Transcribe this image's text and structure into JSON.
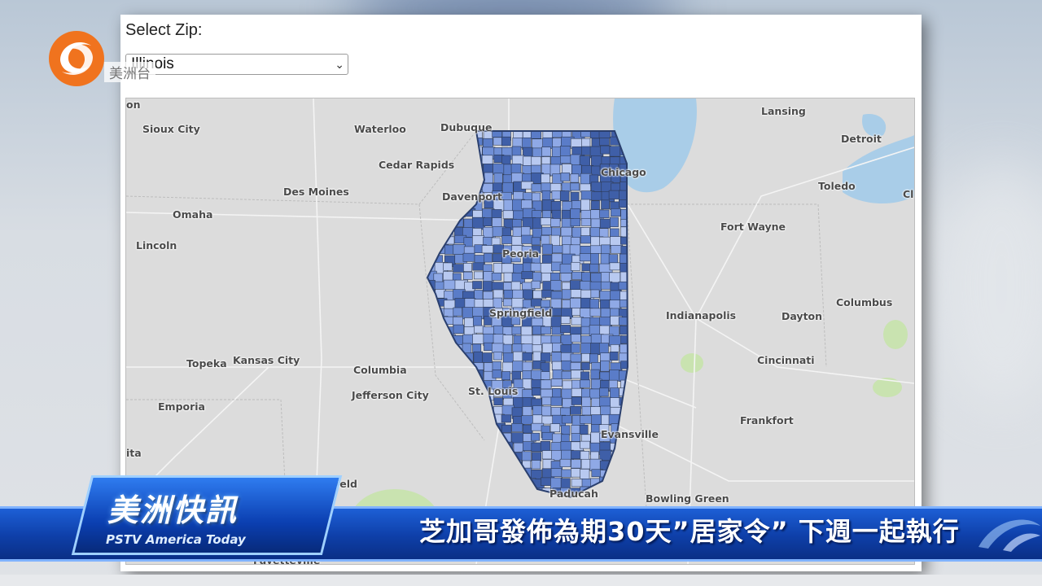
{
  "page": {
    "select_label": "Select Zip:",
    "select_value": "Illinois"
  },
  "map": {
    "cities": [
      {
        "name": "Sioux City"
      },
      {
        "name": "Waterloo"
      },
      {
        "name": "Dubuque"
      },
      {
        "name": "Lansing"
      },
      {
        "name": "Detroit"
      },
      {
        "name": "Cedar Rapids"
      },
      {
        "name": "Chicago"
      },
      {
        "name": "Des Moines"
      },
      {
        "name": "Davenport"
      },
      {
        "name": "Toledo"
      },
      {
        "name": "Omaha"
      },
      {
        "name": "Fort Wayne"
      },
      {
        "name": "Lincoln"
      },
      {
        "name": "Peoria"
      },
      {
        "name": "Springfield"
      },
      {
        "name": "Indianapolis"
      },
      {
        "name": "Dayton"
      },
      {
        "name": "Columbus"
      },
      {
        "name": "Topeka"
      },
      {
        "name": "Kansas City"
      },
      {
        "name": "Columbia"
      },
      {
        "name": "Cincinnati"
      },
      {
        "name": "Jefferson City"
      },
      {
        "name": "St. Louis"
      },
      {
        "name": "Emporia"
      },
      {
        "name": "Frankfort"
      },
      {
        "name": "Evansville"
      },
      {
        "name": "Paducah"
      },
      {
        "name": "Bowling Green"
      },
      {
        "name": "Fayetteville"
      },
      {
        "name": "ield"
      },
      {
        "name": "ita"
      },
      {
        "name": "Cl"
      },
      {
        "name": "on"
      }
    ]
  },
  "overlay": {
    "logo_text": "美洲台",
    "brand_title": "美洲快訊",
    "brand_subtitle": "PSTV America Today",
    "headline": "芝加哥發佈為期30天”居家令” 下週一起執行"
  },
  "colors": {
    "ticker": "#0e3fa8",
    "zip_dark": "#3f5fa8",
    "zip_mid": "#6f8fd6",
    "zip_light": "#b8c9f0",
    "lake": "#a9cde8"
  }
}
